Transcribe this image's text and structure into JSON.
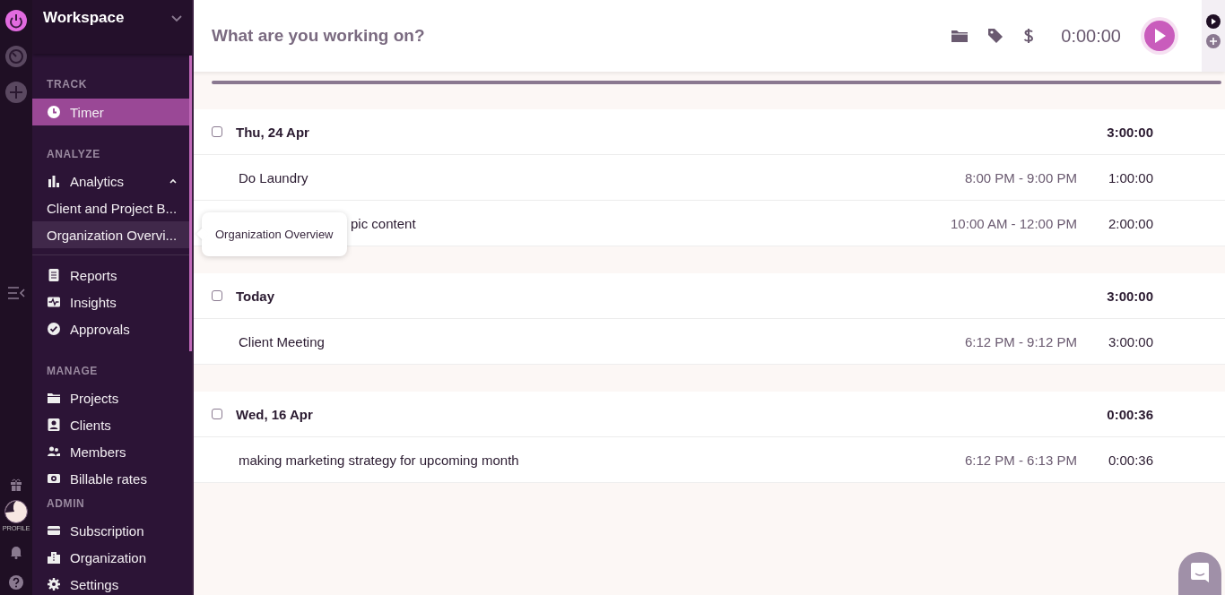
{
  "rail": {
    "profile_label": "PROFILE"
  },
  "sidebar": {
    "workspace": "Workspace",
    "sections": [
      {
        "title": "TRACK",
        "items": [
          {
            "label": "Timer",
            "selected": true
          }
        ]
      },
      {
        "title": "ANALYZE",
        "items": [
          {
            "label": "Analytics",
            "selected": false,
            "expanded": true,
            "children": [
              {
                "label": "Client and Project B...",
                "highlighted": false
              },
              {
                "label": "Organization Overvi...",
                "highlighted": true
              }
            ]
          }
        ]
      },
      {
        "items": [
          {
            "label": "Reports",
            "selected": false
          },
          {
            "label": "Insights",
            "selected": false
          },
          {
            "label": "Approvals",
            "selected": false
          }
        ]
      },
      {
        "title": "MANAGE",
        "items": [
          {
            "label": "Projects",
            "selected": false
          },
          {
            "label": "Clients",
            "selected": false
          },
          {
            "label": "Members",
            "selected": false
          },
          {
            "label": "Billable rates",
            "selected": false
          }
        ]
      },
      {
        "title": "ADMIN",
        "items": [
          {
            "label": "Subscription",
            "selected": false
          },
          {
            "label": "Organization",
            "selected": false
          },
          {
            "label": "Settings",
            "selected": false
          }
        ]
      }
    ]
  },
  "timer": {
    "placeholder": "What are you working on?",
    "time": "0:00:00"
  },
  "groups": [
    {
      "date": "Thu, 24 Apr",
      "total": "3:00:00",
      "checked": false,
      "entries": [
        {
          "description": "Do Laundry",
          "range": "8:00 PM - 9:00 PM",
          "duration": "1:00:00"
        },
        {
          "description": "pic content",
          "range": "10:00 AM - 12:00 PM",
          "duration": "2:00:00"
        }
      ]
    },
    {
      "date": "Today",
      "total": "3:00:00",
      "checked": false,
      "entries": [
        {
          "description": "Client Meeting",
          "range": "6:12 PM - 9:12 PM",
          "duration": "3:00:00"
        }
      ]
    },
    {
      "date": "Wed, 16 Apr",
      "total": "0:00:36",
      "checked": false,
      "entries": [
        {
          "description": "making marketing strategy for upcoming month",
          "range": "6:12 PM - 6:13 PM",
          "duration": "0:00:36"
        }
      ]
    }
  ],
  "tooltip": "Organization Overview"
}
